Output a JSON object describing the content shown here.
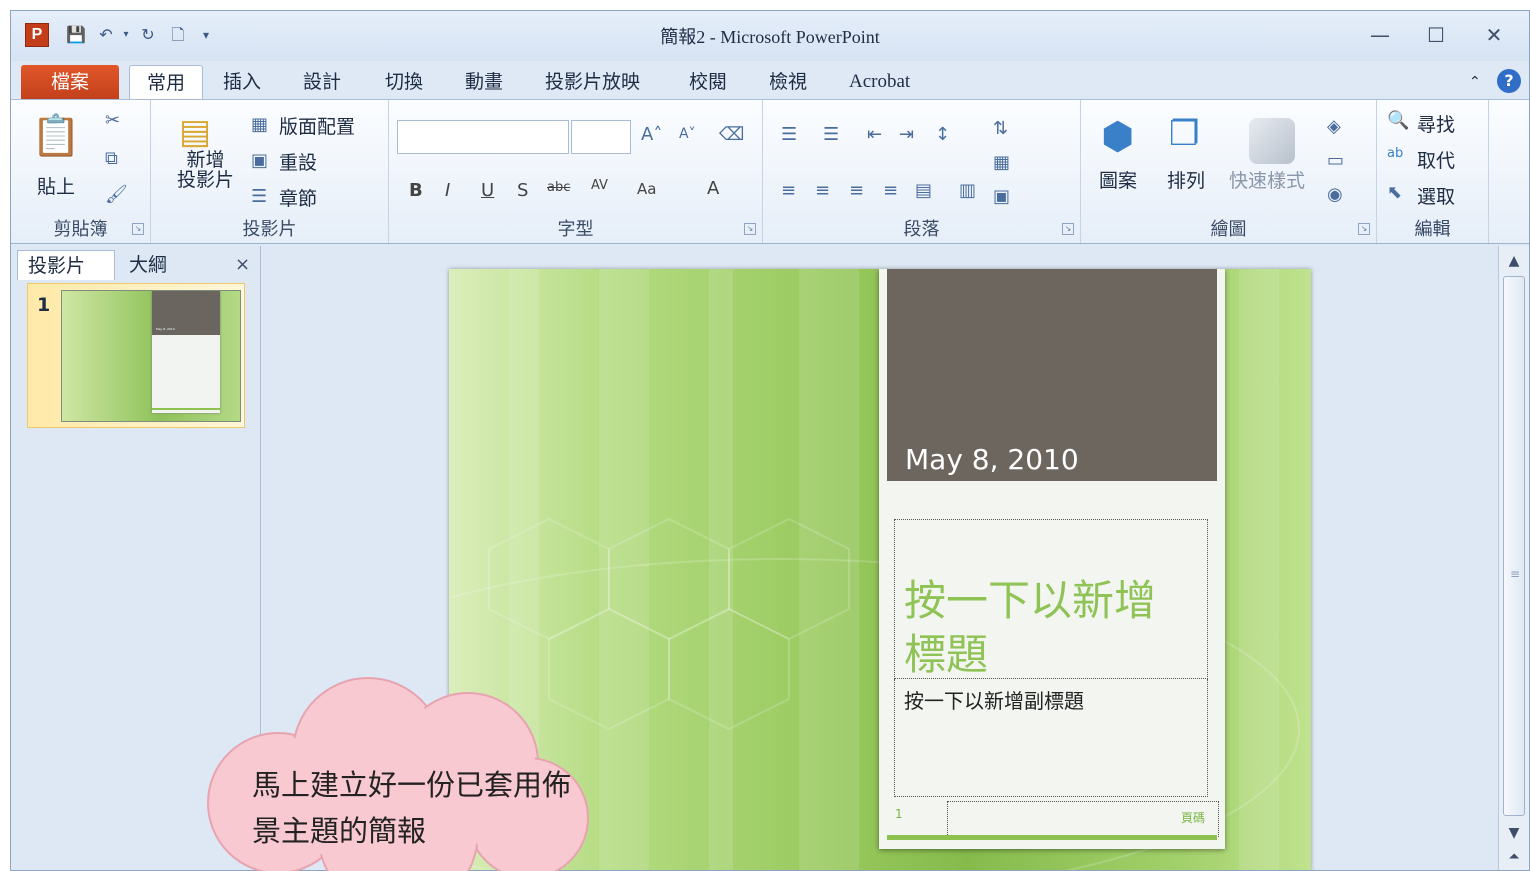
{
  "window": {
    "title": "簡報2 - Microsoft PowerPoint",
    "app_icon": "P",
    "minimize": "—",
    "maximize": "☐",
    "close": "✕"
  },
  "quick_access": [
    "save-icon",
    "undo-icon",
    "redo-icon",
    "new-icon",
    "customize-icon"
  ],
  "tabs": [
    "檔案",
    "常用",
    "插入",
    "設計",
    "切換",
    "動畫",
    "投影片放映",
    "校閱",
    "檢視",
    "Acrobat"
  ],
  "ribbon": {
    "clipboard": {
      "label": "剪貼簿",
      "paste": "貼上"
    },
    "slides": {
      "label": "投影片",
      "new_slide_line1": "新增",
      "new_slide_line2": "投影片",
      "layout": "版面配置",
      "reset": "重設",
      "section": "章節"
    },
    "font": {
      "label": "字型",
      "font_name": "",
      "font_size": ""
    },
    "paragraph": {
      "label": "段落"
    },
    "drawing": {
      "label": "繪圖",
      "shapes": "圖案",
      "arrange": "排列",
      "quick_styles": "快速樣式"
    },
    "editing": {
      "label": "編輯",
      "find": "尋找",
      "replace": "取代",
      "select": "選取"
    }
  },
  "slide_panel": {
    "tab_slides": "投影片",
    "tab_outline": "大綱",
    "close": "×",
    "thumbnail_number": "1",
    "thumbnail_date": "May 8, 2010"
  },
  "slide": {
    "date": "May 8, 2010",
    "title_placeholder": "按一下以新增標題",
    "subtitle_placeholder": "按一下以新增副標題",
    "slide_number": "1",
    "footer": "頁碼"
  },
  "callout": {
    "text": "馬上建立好一份已套用佈景主題的簡報"
  },
  "colors": {
    "file_tab": "#c2401b",
    "slide_green": "#8fc355",
    "card_dark": "#6c665e",
    "callout_pink": "#f8c9d0"
  }
}
